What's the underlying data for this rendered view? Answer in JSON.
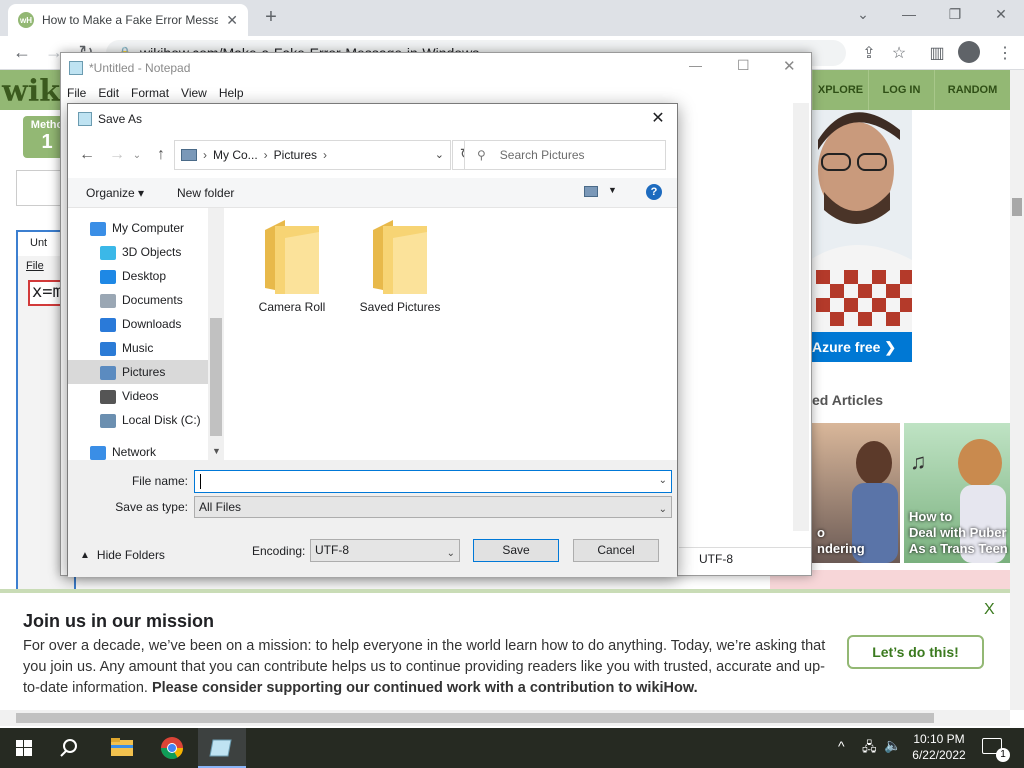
{
  "browser": {
    "tab_title": "How to Make a Fake Error Message",
    "tab_close": "✕",
    "new_tab": "+",
    "url": "wikihow.com/Make-a-Fake-Error-Message-in-Windows",
    "window_controls": [
      "⌄",
      "—",
      "❐",
      "✕"
    ],
    "nav_icons": [
      "back-icon",
      "forward-icon",
      "reload-icon"
    ],
    "toolbar_icons": [
      "share-icon",
      "star-icon",
      "sidebar-icon",
      "profile-icon",
      "menu-icon"
    ]
  },
  "wiki": {
    "logo": "wik",
    "nav": [
      "XPLORE",
      "LOG IN",
      "RANDOM"
    ],
    "method_label": "Metho",
    "method_number": "1",
    "ad_cta": "Azure free ❯",
    "related_title": "ed Articles",
    "related_cards": [
      "o\nndering",
      "How to\nDeal with Puber\nAs a Trans Teen"
    ]
  },
  "notepad": {
    "title": "*Untitled - Notepad",
    "menu": [
      "File",
      "Edit",
      "Format",
      "View",
      "Help"
    ],
    "encoding_status": "UTF-8",
    "mini_title": "Unt",
    "mini_menu": "File",
    "mini_text": "x=m"
  },
  "dialog": {
    "title": "Save As",
    "address_segments": [
      "My Co...",
      "Pictures"
    ],
    "search_placeholder": "Search Pictures",
    "organize": "Organize ▾",
    "new_folder": "New folder",
    "help": "?",
    "tree": [
      {
        "label": "My Computer",
        "icon": "computer-icon",
        "color": "#3a8ee6",
        "indent": 0
      },
      {
        "label": "3D Objects",
        "icon": "cube-icon",
        "color": "#3bb8e8",
        "indent": 1
      },
      {
        "label": "Desktop",
        "icon": "desktop-icon",
        "color": "#1e88e5",
        "indent": 1
      },
      {
        "label": "Documents",
        "icon": "document-icon",
        "color": "#9aa7b4",
        "indent": 1
      },
      {
        "label": "Downloads",
        "icon": "download-icon",
        "color": "#2a7ad9",
        "indent": 1
      },
      {
        "label": "Music",
        "icon": "music-icon",
        "color": "#2b7bd6",
        "indent": 1
      },
      {
        "label": "Pictures",
        "icon": "pictures-icon",
        "color": "#5b8bc0",
        "indent": 1,
        "selected": true
      },
      {
        "label": "Videos",
        "icon": "video-icon",
        "color": "#555555",
        "indent": 1
      },
      {
        "label": "Local Disk (C:)",
        "icon": "disk-icon",
        "color": "#6b8fb0",
        "indent": 1
      },
      {
        "label": "Network",
        "icon": "network-icon",
        "color": "#3a8ee6",
        "indent": 0
      }
    ],
    "folders": [
      "Camera Roll",
      "Saved Pictures"
    ],
    "file_name_label": "File name:",
    "file_name_value": "",
    "save_type_label": "Save as type:",
    "save_type_value": "All Files",
    "hide_folders": "Hide Folders",
    "encoding_label": "Encoding:",
    "encoding_value": "UTF-8",
    "save": "Save",
    "cancel": "Cancel"
  },
  "banner": {
    "title": "Join us in our mission",
    "text": "For over a decade, we’ve been on a mission: to help everyone in the world learn how to do anything. Today, we’re asking that you join us. Any amount that you can contribute helps us to continue providing readers like you with trusted, accurate and up-to-date information.",
    "bold_text": "Please consider supporting our continued work with a contribution to wikiHow.",
    "cta": "Let’s do this!",
    "close": "X"
  },
  "taskbar": {
    "time": "10:10 PM",
    "date": "6/22/2022",
    "notification_count": "1",
    "tray_icons": [
      "chevron-up-icon",
      "network-icon",
      "volume-icon"
    ]
  }
}
